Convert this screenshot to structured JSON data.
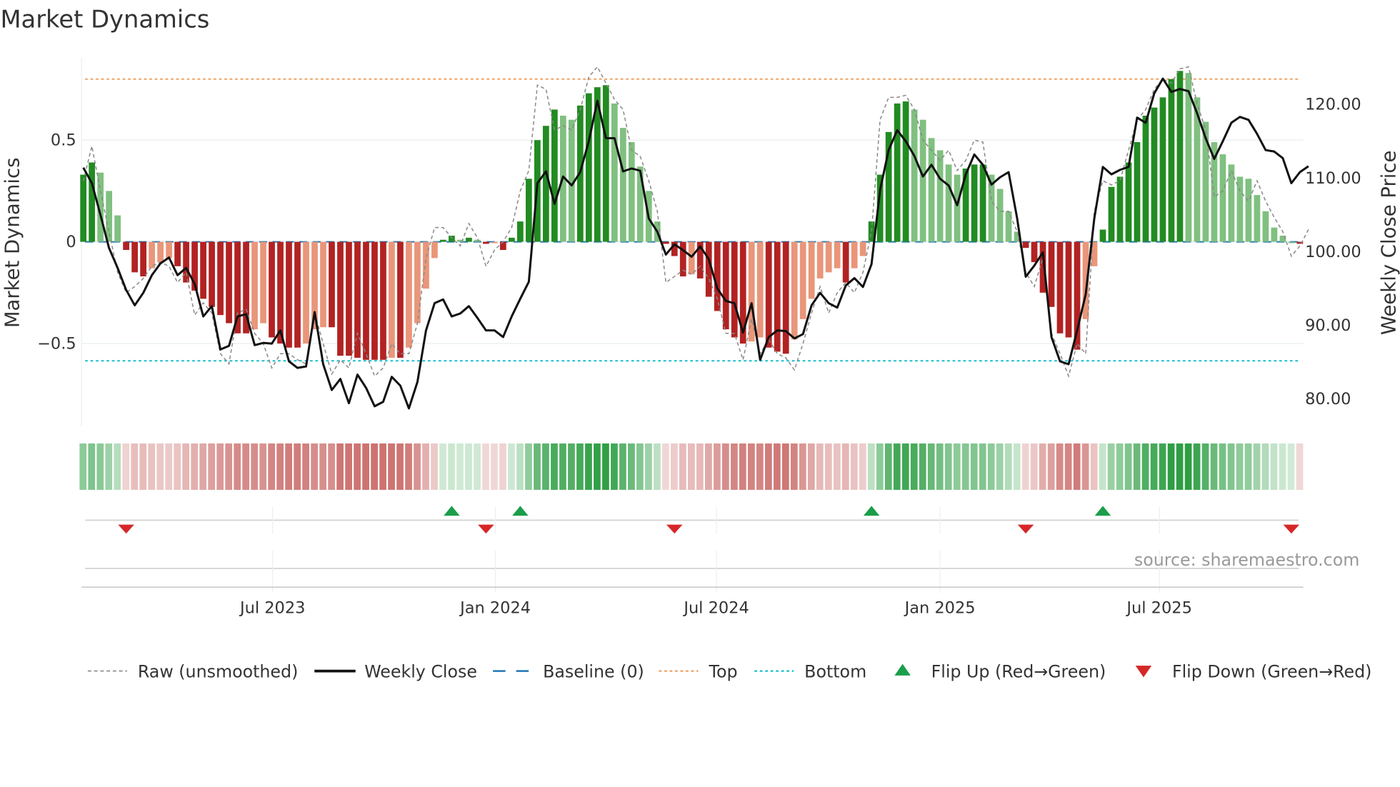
{
  "chart_data": {
    "type": "bar",
    "title": "Market Dynamics",
    "ylabel": "Market Dynamics",
    "y2label": "Weekly Close Price",
    "ylim": [
      -0.9,
      0.92
    ],
    "y2lim": [
      76.5,
      126.5
    ],
    "yticks": [
      {
        "v": 0.5,
        "label": "0.5"
      },
      {
        "v": 0,
        "label": "0"
      },
      {
        "v": -0.5,
        "label": "−0.5"
      }
    ],
    "y2ticks": [
      {
        "v": 120,
        "label": "120.00"
      },
      {
        "v": 110,
        "label": "110.00"
      },
      {
        "v": 100,
        "label": "100.00"
      },
      {
        "v": 90,
        "label": "90.00"
      },
      {
        "v": 80,
        "label": "80.00"
      }
    ],
    "xticks": [
      {
        "week": 22.1,
        "label": "Jul 2023"
      },
      {
        "week": 48.1,
        "label": "Jan 2024"
      },
      {
        "week": 73.9,
        "label": "Jul 2024"
      },
      {
        "week": 100,
        "label": "Jan 2025"
      },
      {
        "week": 125.6,
        "label": "Jul 2025"
      }
    ],
    "top_level": 0.8,
    "bottom_level": -0.585,
    "baseline": 0,
    "dynamics": [
      0.33,
      0.39,
      0.34,
      0.25,
      0.13,
      -0.04,
      -0.15,
      -0.17,
      -0.13,
      -0.1,
      -0.08,
      -0.12,
      -0.2,
      -0.24,
      -0.28,
      -0.32,
      -0.36,
      -0.4,
      -0.45,
      -0.45,
      -0.43,
      -0.4,
      -0.47,
      -0.5,
      -0.52,
      -0.52,
      -0.5,
      -0.43,
      -0.42,
      -0.42,
      -0.56,
      -0.56,
      -0.57,
      -0.58,
      -0.58,
      -0.58,
      -0.57,
      -0.57,
      -0.52,
      -0.4,
      -0.23,
      -0.08,
      0.01,
      0.03,
      0.01,
      0.02,
      0.01,
      -0.01,
      -0.005,
      -0.04,
      0.02,
      0.1,
      0.31,
      0.5,
      0.57,
      0.65,
      0.62,
      0.6,
      0.67,
      0.73,
      0.76,
      0.77,
      0.68,
      0.56,
      0.49,
      0.37,
      0.25,
      0.1,
      -0.01,
      -0.07,
      -0.17,
      -0.16,
      -0.18,
      -0.27,
      -0.34,
      -0.43,
      -0.47,
      -0.5,
      -0.49,
      -0.47,
      -0.52,
      -0.54,
      -0.55,
      -0.48,
      -0.38,
      -0.28,
      -0.18,
      -0.15,
      -0.13,
      -0.2,
      -0.13,
      -0.07,
      0.1,
      0.33,
      0.54,
      0.68,
      0.69,
      0.65,
      0.6,
      0.51,
      0.45,
      0.38,
      0.33,
      0.36,
      0.38,
      0.38,
      0.33,
      0.26,
      0.15,
      0.05,
      -0.03,
      -0.1,
      -0.25,
      -0.32,
      -0.45,
      -0.47,
      -0.53,
      -0.38,
      -0.12,
      0.06,
      0.27,
      0.32,
      0.39,
      0.49,
      0.62,
      0.66,
      0.71,
      0.8,
      0.84,
      0.83,
      0.71,
      0.59,
      0.49,
      0.43,
      0.38,
      0.32,
      0.31,
      0.23,
      0.15,
      0.07,
      0.03,
      0.0,
      -0.01
    ],
    "raw": [
      0.3,
      0.47,
      0.25,
      0.05,
      -0.15,
      -0.25,
      -0.22,
      -0.18,
      -0.12,
      -0.1,
      -0.12,
      -0.2,
      -0.15,
      -0.36,
      -0.3,
      -0.35,
      -0.55,
      -0.6,
      -0.35,
      -0.33,
      -0.45,
      -0.5,
      -0.62,
      -0.55,
      -0.55,
      -0.58,
      -0.6,
      -0.35,
      -0.5,
      -0.65,
      -0.58,
      -0.62,
      -0.45,
      -0.55,
      -0.66,
      -0.62,
      -0.5,
      -0.55,
      -0.55,
      -0.4,
      -0.08,
      0.07,
      0.07,
      0.02,
      -0.02,
      0.09,
      0.02,
      -0.12,
      -0.04,
      0.0,
      0.07,
      0.25,
      0.35,
      0.77,
      0.75,
      0.55,
      0.57,
      0.55,
      0.65,
      0.81,
      0.86,
      0.78,
      0.7,
      0.65,
      0.45,
      0.42,
      0.3,
      0.15,
      -0.2,
      -0.17,
      -0.14,
      -0.16,
      -0.12,
      -0.18,
      -0.28,
      -0.45,
      -0.45,
      -0.58,
      -0.38,
      -0.55,
      -0.48,
      -0.55,
      -0.57,
      -0.63,
      -0.5,
      -0.35,
      -0.22,
      -0.35,
      -0.25,
      -0.2,
      -0.25,
      -0.15,
      0.05,
      0.6,
      0.71,
      0.71,
      0.72,
      0.65,
      0.5,
      0.45,
      0.4,
      0.45,
      0.35,
      0.4,
      0.5,
      0.49,
      0.2,
      0.15,
      0.15,
      0.05,
      -0.15,
      -0.22,
      -0.08,
      -0.45,
      -0.55,
      -0.66,
      -0.5,
      -0.55,
      0.15,
      0.3,
      0.28,
      0.3,
      0.45,
      0.6,
      0.65,
      0.75,
      0.8,
      0.78,
      0.85,
      0.86,
      0.68,
      0.55,
      0.22,
      0.25,
      0.35,
      0.25,
      0.2,
      0.3,
      0.2,
      0.12,
      0.05,
      -0.07,
      -0.02,
      0.06
    ],
    "weekly_close": [
      111.4,
      109.3,
      105.0,
      100.5,
      97.8,
      94.8,
      92.7,
      94.4,
      96.8,
      98.4,
      99.2,
      96.8,
      97.8,
      95.6,
      91.2,
      92.6,
      86.7,
      87.2,
      91.2,
      91.5,
      87.3,
      87.6,
      87.5,
      89.3,
      85.1,
      84.2,
      84.4,
      91.8,
      84.7,
      81.2,
      82.7,
      79.4,
      83.3,
      81.5,
      79.0,
      79.6,
      83.0,
      81.8,
      78.7,
      82.3,
      89.3,
      93.0,
      93.5,
      91.2,
      91.6,
      92.6,
      91.0,
      89.3,
      89.3,
      88.4,
      91.2,
      93.6,
      95.9,
      109.3,
      110.9,
      106.5,
      110.2,
      109.0,
      110.8,
      115.0,
      120.5,
      115.4,
      115.4,
      110.9,
      111.3,
      111.0,
      104.5,
      102.7,
      99.6,
      101.0,
      100.2,
      99.3,
      100.7,
      99.0,
      95.0,
      93.3,
      93.0,
      89.0,
      93.0,
      85.3,
      88.4,
      89.3,
      89.2,
      88.2,
      88.8,
      92.7,
      94.4,
      93.0,
      92.4,
      95.4,
      96.4,
      95.2,
      98.3,
      108.4,
      113.8,
      116.5,
      115.0,
      113.0,
      110.2,
      111.8,
      109.9,
      109.0,
      106.3,
      110.5,
      113.2,
      111.8,
      109.1,
      110.1,
      110.8,
      104.5,
      96.6,
      98.1,
      99.9,
      88.4,
      85.1,
      84.7,
      89.3,
      94.2,
      104.5,
      111.5,
      110.5,
      111.1,
      111.5,
      118.2,
      117.5,
      121.5,
      123.5,
      121.7,
      122.1,
      121.8,
      118.8,
      115.4,
      112.6,
      115.0,
      117.5,
      118.3,
      117.9,
      116.0,
      113.8,
      113.6,
      112.7,
      109.3,
      110.8,
      111.6
    ],
    "flip_up_weeks": [
      43,
      51,
      92,
      119
    ],
    "flip_down_weeks": [
      5,
      47,
      69,
      110,
      141
    ],
    "legend": [
      {
        "label": "Raw (unsmoothed)",
        "kind": "raw"
      },
      {
        "label": "Weekly Close",
        "kind": "close"
      },
      {
        "label": "Baseline (0)",
        "kind": "baseline"
      },
      {
        "label": "Top",
        "kind": "top"
      },
      {
        "label": "Bottom",
        "kind": "bottom"
      },
      {
        "label": "Flip Up (Red→Green)",
        "kind": "up"
      },
      {
        "label": "Flip Down (Green→Red)",
        "kind": "down"
      }
    ],
    "legend_placement": "bottom",
    "source": "source: sharemaestro.com",
    "colors": {
      "green_dark": "#228b22",
      "green_light": "#80c080",
      "red_dark": "#b22222",
      "red_light": "#e9967a",
      "strip_green": "#2e9e44",
      "strip_red": "#c0504d",
      "top": "#f0a060",
      "bottom": "#17becf",
      "baseline": "#1f77b4",
      "close": "#111111",
      "raw": "#888888",
      "flip_up": "#1a9e4a",
      "flip_down": "#d62728"
    }
  }
}
